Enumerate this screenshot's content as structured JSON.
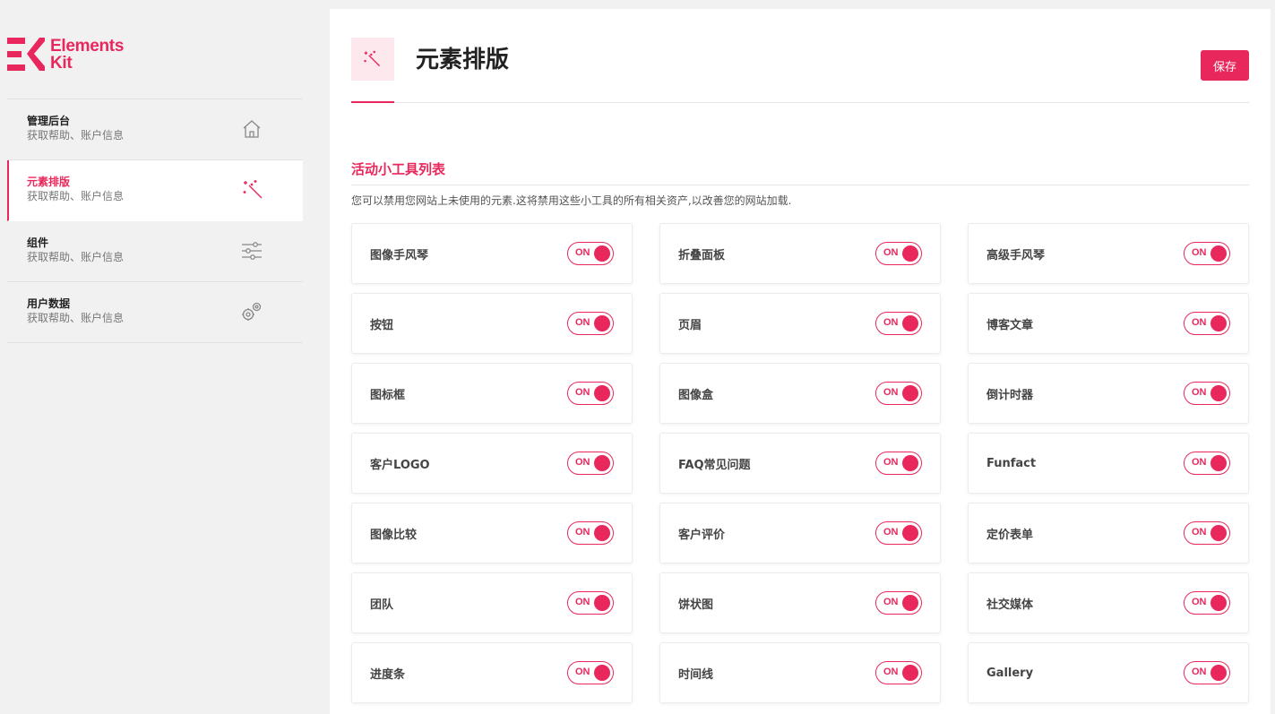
{
  "brand": {
    "name_line1": "Elements",
    "name_line2": "Kit",
    "accent": "#e8285c"
  },
  "sidebar": {
    "items": [
      {
        "title": "管理后台",
        "subtitle": "获取帮助、账户信息",
        "icon": "home-icon",
        "active": false
      },
      {
        "title": "元素排版",
        "subtitle": "获取帮助、账户信息",
        "icon": "magic-wand-icon",
        "active": true
      },
      {
        "title": "组件",
        "subtitle": "获取帮助、账户信息",
        "icon": "sliders-icon",
        "active": false
      },
      {
        "title": "用户数据",
        "subtitle": "获取帮助、账户信息",
        "icon": "gears-icon",
        "active": false
      }
    ]
  },
  "header": {
    "title": "元素排版",
    "icon": "magic-wand-icon",
    "save_label": "保存"
  },
  "section": {
    "title": "活动小工具列表",
    "description": "您可以禁用您网站上未使用的元素.这将禁用这些小工具的所有相关资产,以改善您的网站加载."
  },
  "toggle_on_label": "ON",
  "widgets": [
    {
      "label": "图像手风琴",
      "state": "ON"
    },
    {
      "label": "折叠面板",
      "state": "ON"
    },
    {
      "label": "高级手风琴",
      "state": "ON"
    },
    {
      "label": "按钮",
      "state": "ON"
    },
    {
      "label": "页眉",
      "state": "ON"
    },
    {
      "label": "博客文章",
      "state": "ON"
    },
    {
      "label": "图标框",
      "state": "ON"
    },
    {
      "label": "图像盒",
      "state": "ON"
    },
    {
      "label": "倒计时器",
      "state": "ON"
    },
    {
      "label": "客户LOGO",
      "state": "ON"
    },
    {
      "label": "FAQ常见问题",
      "state": "ON"
    },
    {
      "label": "Funfact",
      "state": "ON"
    },
    {
      "label": "图像比较",
      "state": "ON"
    },
    {
      "label": "客户评价",
      "state": "ON"
    },
    {
      "label": "定价表单",
      "state": "ON"
    },
    {
      "label": "团队",
      "state": "ON"
    },
    {
      "label": "饼状图",
      "state": "ON"
    },
    {
      "label": "社交媒体",
      "state": "ON"
    },
    {
      "label": "进度条",
      "state": "ON"
    },
    {
      "label": "时间线",
      "state": "ON"
    },
    {
      "label": "Gallery",
      "state": "ON"
    }
  ]
}
